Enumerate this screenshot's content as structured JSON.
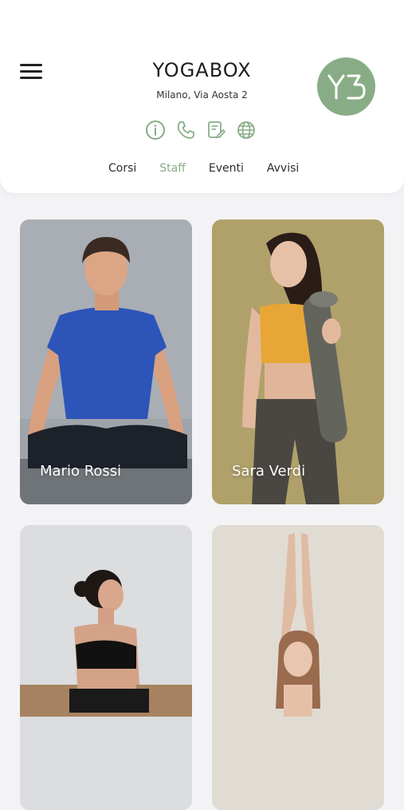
{
  "header": {
    "brand": "YOGABOX",
    "address": "Milano, Via Aosta 2",
    "logo_text": "YB",
    "accent_color": "#88ad86"
  },
  "actions": [
    {
      "icon": "info-icon"
    },
    {
      "icon": "phone-icon"
    },
    {
      "icon": "edit-note-icon"
    },
    {
      "icon": "globe-icon"
    }
  ],
  "tabs": [
    {
      "label": "Corsi",
      "active": false
    },
    {
      "label": "Staff",
      "active": true
    },
    {
      "label": "Eventi",
      "active": false
    },
    {
      "label": "Avvisi",
      "active": false
    }
  ],
  "staff": [
    {
      "name": "Mario Rossi"
    },
    {
      "name": "Sara Verdi"
    },
    {
      "name": ""
    },
    {
      "name": ""
    }
  ]
}
